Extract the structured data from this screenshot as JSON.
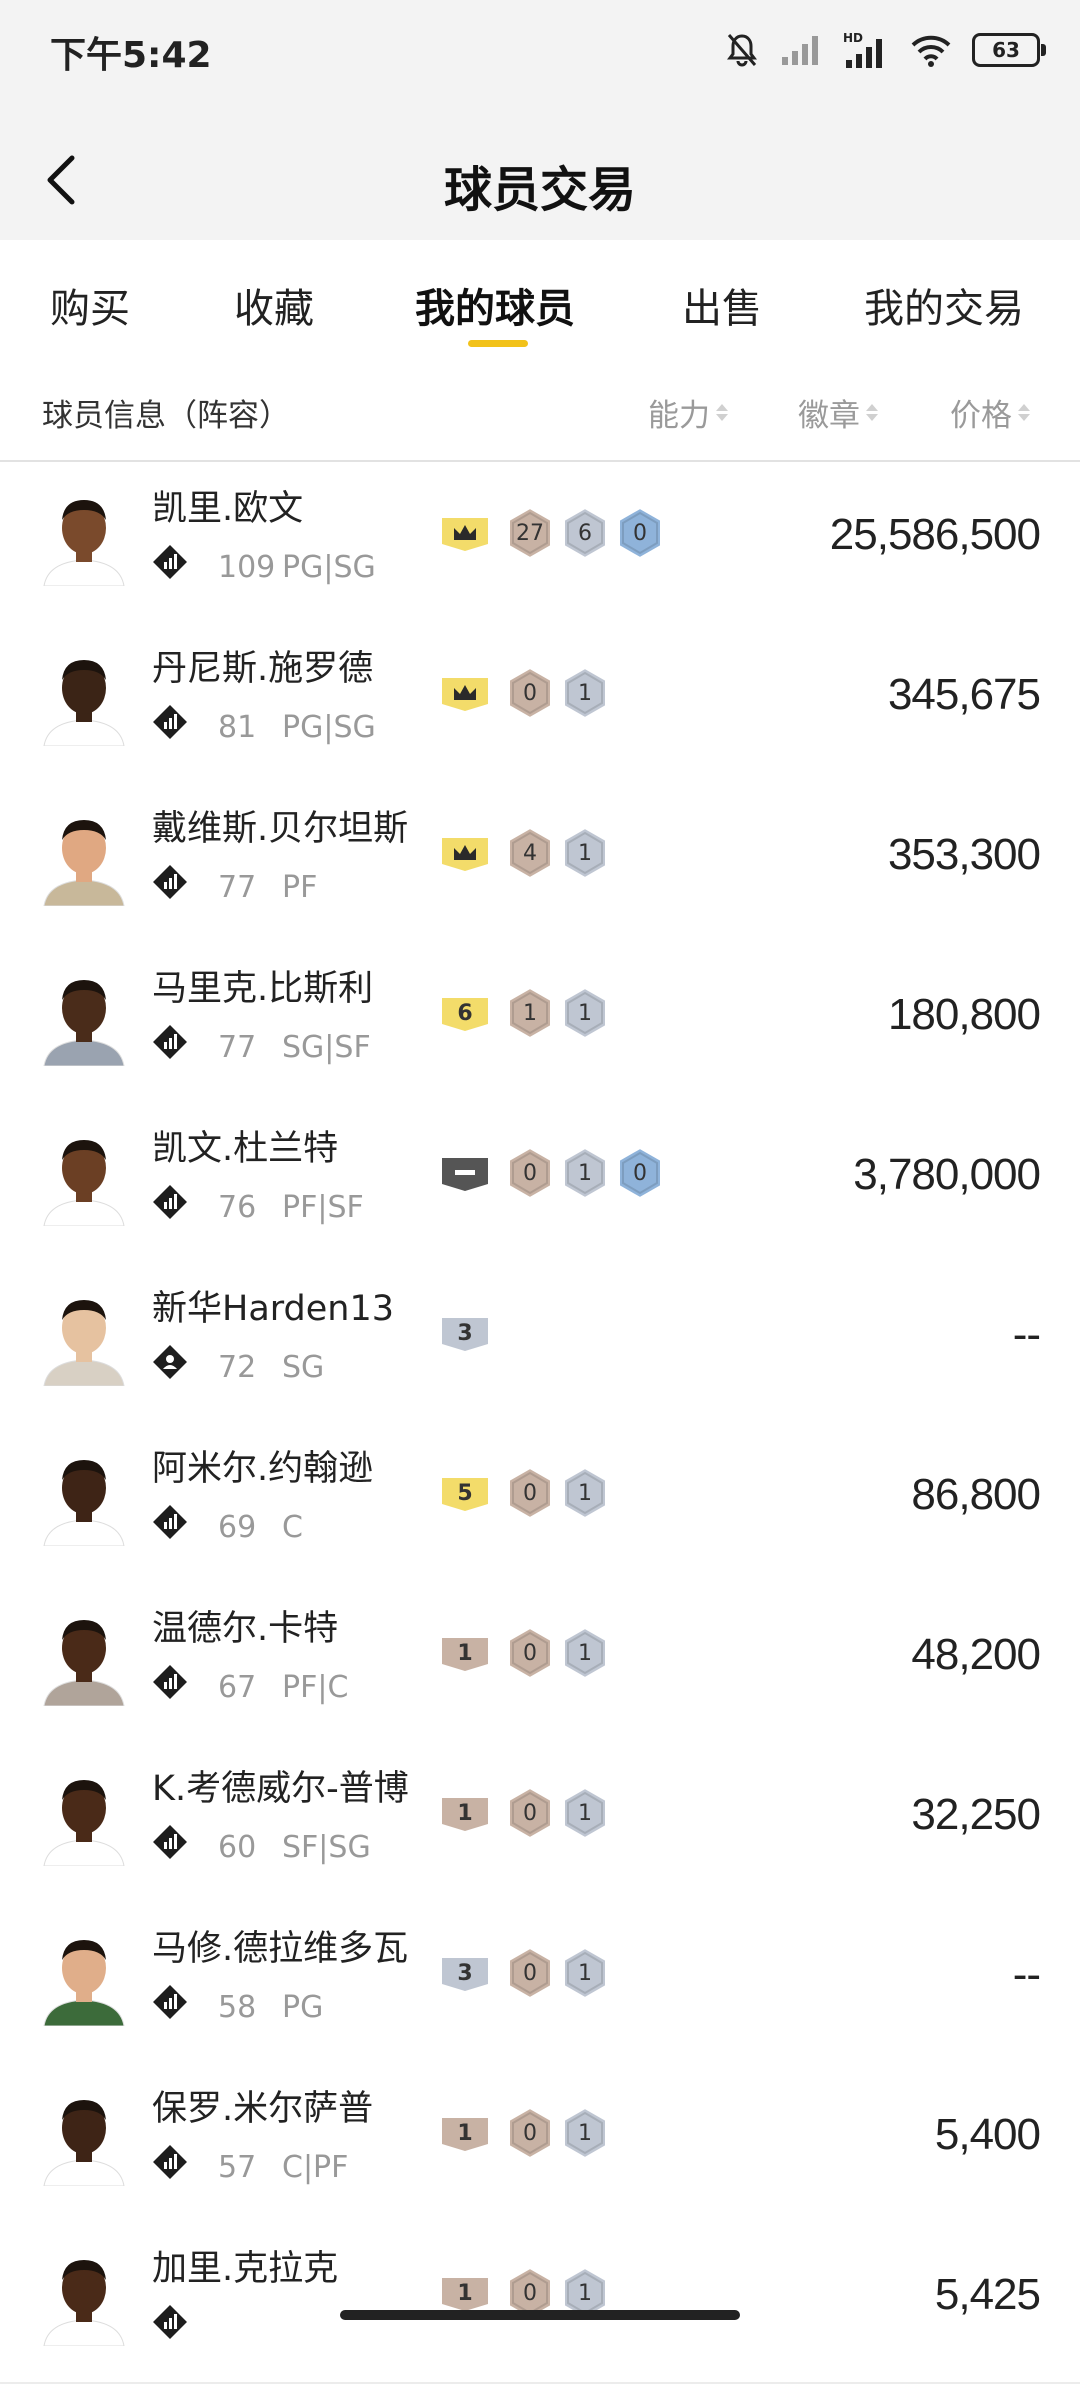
{
  "status": {
    "time": "下午5:42",
    "battery": "63"
  },
  "header": {
    "title": "球员交易"
  },
  "tabs": [
    "购买",
    "收藏",
    "我的球员",
    "出售",
    "我的交易"
  ],
  "active_tab": 2,
  "columns": {
    "info": "球员信息（阵容）",
    "ability": "能力",
    "badge": "徽章",
    "price": "价格"
  },
  "players": [
    {
      "name": "凯里.欧文",
      "ovr": "109",
      "pos": "PG|SG",
      "tier": "crown",
      "tier_label": "",
      "badges": [
        "27",
        "6",
        "0"
      ],
      "price": "25,586,500",
      "skin": "#7a4a2c",
      "jersey": "#ffffff",
      "tag": "bars"
    },
    {
      "name": "丹尼斯.施罗德",
      "ovr": "81",
      "pos": "PG|SG",
      "tier": "crown",
      "tier_label": "",
      "badges": [
        "0",
        "1"
      ],
      "price": "345,675",
      "skin": "#3b2416",
      "jersey": "#ffffff",
      "tag": "bars"
    },
    {
      "name": "戴维斯.贝尔坦斯",
      "ovr": "77",
      "pos": "PF",
      "tier": "crown",
      "tier_label": "",
      "badges": [
        "4",
        "1"
      ],
      "price": "353,300",
      "skin": "#e0a882",
      "jersey": "#c8b89a",
      "tag": "bars"
    },
    {
      "name": "马里克.比斯利",
      "ovr": "77",
      "pos": "SG|SF",
      "tier": "gold",
      "tier_label": "6",
      "badges": [
        "1",
        "1"
      ],
      "price": "180,800",
      "skin": "#4a2c1a",
      "jersey": "#9aa3b0",
      "tag": "bars"
    },
    {
      "name": "凯文.杜兰特",
      "ovr": "76",
      "pos": "PF|SF",
      "tier": "dark",
      "tier_label": "",
      "badges": [
        "0",
        "1",
        "0"
      ],
      "price": "3,780,000",
      "skin": "#6b3f24",
      "jersey": "#ffffff",
      "tag": "bars"
    },
    {
      "name": "新华Harden13",
      "ovr": "72",
      "pos": "SG",
      "tier": "silver",
      "tier_label": "3",
      "badges": [],
      "price": "--",
      "skin": "#e6c2a0",
      "jersey": "#d8d0c4",
      "tag": "person"
    },
    {
      "name": "阿米尔.约翰逊",
      "ovr": "69",
      "pos": "C",
      "tier": "gold",
      "tier_label": "5",
      "badges": [
        "0",
        "1"
      ],
      "price": "86,800",
      "skin": "#3e2416",
      "jersey": "#ffffff",
      "tag": "bars"
    },
    {
      "name": "温德尔.卡特",
      "ovr": "67",
      "pos": "PF|C",
      "tier": "bronze",
      "tier_label": "1",
      "badges": [
        "0",
        "1"
      ],
      "price": "48,200",
      "skin": "#4a2a18",
      "jersey": "#b0a49a",
      "tag": "bars"
    },
    {
      "name": "K.考德威尔-普博",
      "ovr": "60",
      "pos": "SF|SG",
      "tier": "bronze",
      "tier_label": "1",
      "badges": [
        "0",
        "1"
      ],
      "price": "32,250",
      "skin": "#4a2a18",
      "jersey": "#ffffff",
      "tag": "bars"
    },
    {
      "name": "马修.德拉维多瓦",
      "ovr": "58",
      "pos": "PG",
      "tier": "silver",
      "tier_label": "3",
      "badges": [
        "0",
        "1"
      ],
      "price": "--",
      "skin": "#e0ae8a",
      "jersey": "#3c6b3a",
      "tag": "bars"
    },
    {
      "name": "保罗.米尔萨普",
      "ovr": "57",
      "pos": "C|PF",
      "tier": "bronze",
      "tier_label": "1",
      "badges": [
        "0",
        "1"
      ],
      "price": "5,400",
      "skin": "#3e2416",
      "jersey": "#ffffff",
      "tag": "bars"
    },
    {
      "name": "加里.克拉克",
      "ovr": "",
      "pos": "",
      "tier": "bronze",
      "tier_label": "1",
      "badges": [
        "0",
        "1"
      ],
      "price": "5,425",
      "skin": "#4a2a18",
      "jersey": "#ffffff",
      "tag": "bars"
    }
  ],
  "colors": {
    "accent": "#f2c21a",
    "crown": "#f3dc6a",
    "bronze": "#c8b2a4",
    "silver": "#bfc6d2",
    "blue": "#8fb3da",
    "dark": "#555555"
  }
}
